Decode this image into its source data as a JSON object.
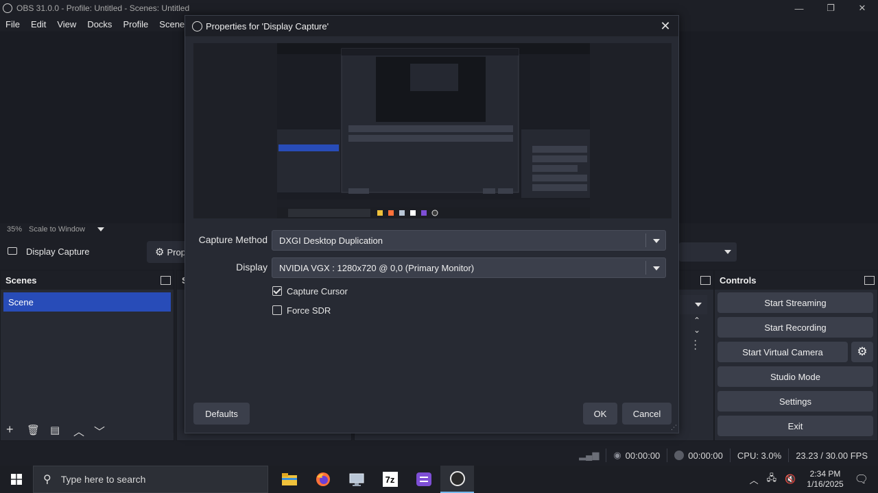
{
  "window": {
    "title": "OBS 31.0.0 - Profile: Untitled - Scenes: Untitled",
    "minimize": "—",
    "restore": "❐",
    "close": "✕"
  },
  "menu": [
    "File",
    "Edit",
    "View",
    "Docks",
    "Profile",
    "Scene"
  ],
  "scale": {
    "percent": "35%",
    "mode": "Scale to Window"
  },
  "source_bar": {
    "selected_source": "Display Capture",
    "properties_label": "Prop"
  },
  "scenes_dock": {
    "title": "Scenes",
    "items": [
      "Scene"
    ]
  },
  "sources_dock": {
    "title": "S"
  },
  "controls_dock": {
    "title": "Controls",
    "buttons": [
      "Start Streaming",
      "Start Recording",
      "Start Virtual Camera",
      "Studio Mode",
      "Settings",
      "Exit"
    ]
  },
  "status": {
    "stream_time": "00:00:00",
    "record_time": "00:00:00",
    "cpu": "CPU: 3.0%",
    "fps": "23.23 / 30.00 FPS"
  },
  "taskbar": {
    "search_placeholder": "Type here to search",
    "time": "2:34 PM",
    "date": "1/16/2025",
    "apps": [
      "file-explorer-icon",
      "firefox-icon",
      "remote-desktop-icon",
      "7zip-icon",
      "notepad-icon",
      "obs-icon"
    ]
  },
  "dialog": {
    "title": "Properties for 'Display Capture'",
    "capture_method_label": "Capture Method",
    "capture_method_value": "DXGI Desktop Duplication",
    "display_label": "Display",
    "display_value": "NVIDIA VGX : 1280x720 @ 0,0 (Primary Monitor)",
    "capture_cursor_label": "Capture Cursor",
    "capture_cursor_checked": true,
    "force_sdr_label": "Force SDR",
    "force_sdr_checked": false,
    "defaults_label": "Defaults",
    "ok_label": "OK",
    "cancel_label": "Cancel"
  },
  "colors": {
    "accent": "#284cb8",
    "panel": "#272a33",
    "button": "#3b3f4b"
  }
}
